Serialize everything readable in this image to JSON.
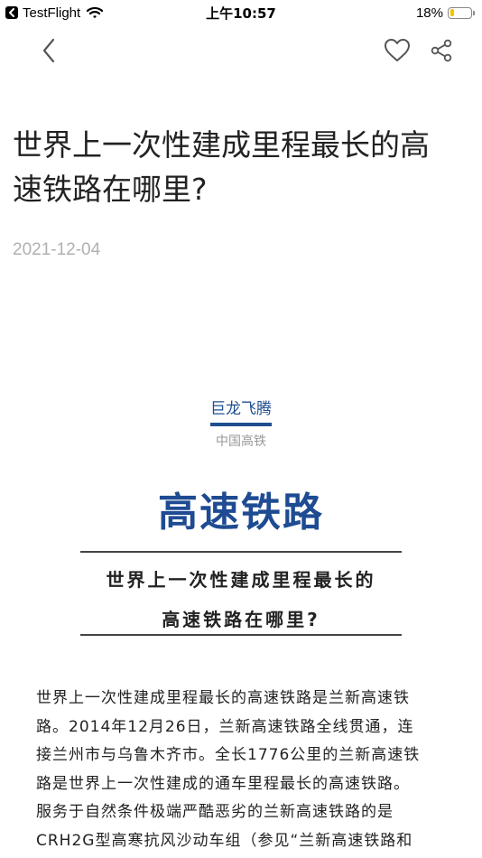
{
  "status_bar": {
    "back_app": "TestFlight",
    "time": "上午10:57",
    "battery_percent": "18%",
    "battery_level": 0.18,
    "battery_color": "#f5c600"
  },
  "nav": {
    "back_icon": "chevron-left-icon",
    "like_icon": "heart-icon",
    "share_icon": "share-icon"
  },
  "article": {
    "title_lines": [
      "世界上一次性建成里程最长的高",
      "速铁路在哪里?"
    ],
    "date": "2021-12-04"
  },
  "content": {
    "brand_name": "巨龙飞腾",
    "brand_sub": "中国高铁",
    "headline": "高速铁路",
    "subhead_lines": [
      "世界上一次性建成里程最长的",
      "高速铁路在哪里?"
    ],
    "body_lines": [
      "世界上一次性建成里程最长的高速铁路是兰新高速铁",
      "路。2014年12月26日，兰新高速铁路全线贯通，连",
      "接兰州市与乌鲁木齐市。全长1776公里的兰新高速铁",
      "路是世界上一次性建成的通车里程最长的高速铁路。",
      "服务于自然条件极端严酷恶劣的兰新高速铁路的是",
      "CRH2G型高寒抗风沙动车组（参见“兰新高速铁路和"
    ]
  },
  "colors": {
    "brand_blue": "#1e4b92",
    "date_gray": "#b0b0b0"
  }
}
